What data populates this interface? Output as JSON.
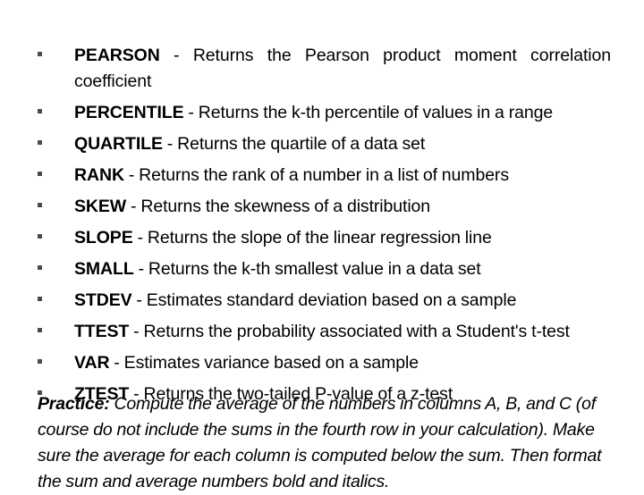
{
  "slide": {
    "background_color": "#ffffff",
    "text_color": "#000000",
    "bullet_color": "#3d4f57",
    "bullet_glyph": "small-square"
  },
  "function_list": {
    "items": [
      {
        "name": "PEARSON",
        "separator": " - ",
        "description": "Returns the Pearson product moment correlation coefficient",
        "justified": true
      },
      {
        "name": "PERCENTILE",
        "separator": " - ",
        "description": "Returns the k-th percentile of values in a range",
        "justified": false
      },
      {
        "name": "QUARTILE",
        "separator": " - ",
        "description": "Returns the quartile of a data set",
        "justified": false
      },
      {
        "name": "RANK",
        "separator": " - ",
        "description": "Returns the rank of a number in a list of numbers",
        "justified": false
      },
      {
        "name": "SKEW",
        "separator": " - ",
        "description": "Returns the skewness of a distribution",
        "justified": false
      },
      {
        "name": "SLOPE",
        "separator": " - ",
        "description": "Returns the slope of the linear regression line",
        "justified": false
      },
      {
        "name": "SMALL",
        "separator": " - ",
        "description": "Returns the k-th smallest value in a data set",
        "justified": false
      },
      {
        "name": "STDEV",
        "separator": " - ",
        "description": "Estimates standard deviation based on a sample",
        "justified": false
      },
      {
        "name": "TTEST",
        "separator": " - ",
        "description": "Returns the probability associated with a Student's t-test",
        "justified": false
      },
      {
        "name": "VAR",
        "separator": " - ",
        "description": "Estimates variance based on a sample",
        "justified": false
      },
      {
        "name": "ZTEST",
        "separator": " - ",
        "description": "Returns the two-tailed P-value of a z-test",
        "justified": false
      }
    ]
  },
  "practice": {
    "label": "Practice:",
    "body": " Compute the average of the numbers in columns A, B, and C (of course do not include the sums in the fourth row in your calculation). Make sure the average for each column is computed below the sum. Then format the sum and average numbers bold and italics."
  }
}
